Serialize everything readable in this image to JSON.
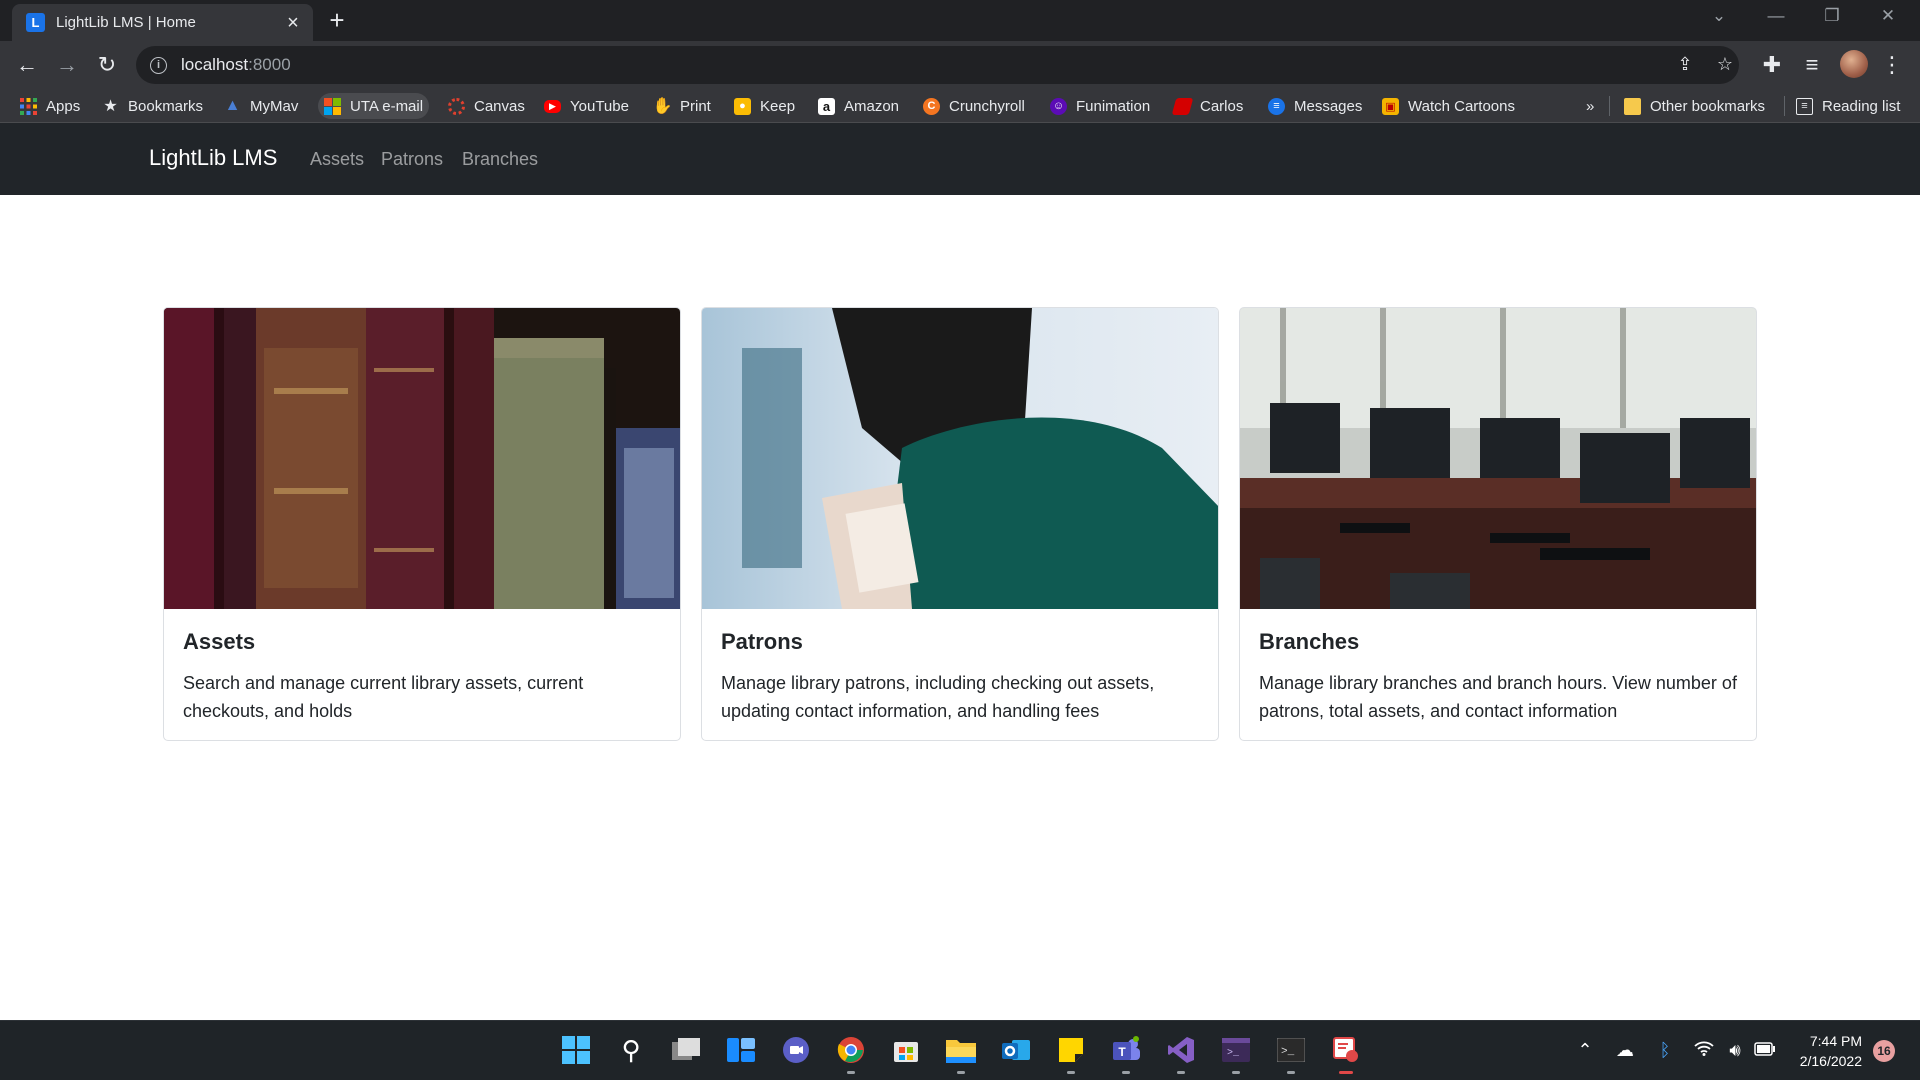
{
  "browser": {
    "tab_title": "LightLib LMS | Home",
    "tab_favicon_letter": "L",
    "url_host": "localhost",
    "url_port": ":8000"
  },
  "bookmarks": [
    {
      "label": "Apps",
      "icon": "apps-grid-icon"
    },
    {
      "label": "Bookmarks",
      "icon": "star-icon"
    },
    {
      "label": "MyMav",
      "icon": "mymav-icon"
    },
    {
      "label": "UTA e-mail",
      "icon": "microsoft-icon"
    },
    {
      "label": "Canvas",
      "icon": "canvas-icon"
    },
    {
      "label": "YouTube",
      "icon": "youtube-icon"
    },
    {
      "label": "Print",
      "icon": "print-icon"
    },
    {
      "label": "Keep",
      "icon": "keep-icon"
    },
    {
      "label": "Amazon",
      "icon": "amazon-icon"
    },
    {
      "label": "Crunchyroll",
      "icon": "crunchyroll-icon"
    },
    {
      "label": "Funimation",
      "icon": "funimation-icon"
    },
    {
      "label": "Carlos",
      "icon": "carlos-icon"
    },
    {
      "label": "Messages",
      "icon": "messages-icon"
    },
    {
      "label": "Watch Cartoons",
      "icon": "cartoons-icon"
    }
  ],
  "bookmarks_overflow": "»",
  "other_bookmarks": "Other bookmarks",
  "reading_list": "Reading list",
  "app": {
    "brand": "LightLib LMS",
    "nav": [
      "Assets",
      "Patrons",
      "Branches"
    ]
  },
  "cards": [
    {
      "title": "Assets",
      "text": "Search and manage current library assets, current checkouts, and holds",
      "image": "old-books-photo"
    },
    {
      "title": "Patrons",
      "text": "Manage library patrons, including checking out assets, updating contact information, and handling fees",
      "image": "woman-reading-photo"
    },
    {
      "title": "Branches",
      "text": "Manage library branches and branch hours. View number of patrons, total assets, and contact information",
      "image": "computer-lab-photo"
    }
  ],
  "taskbar": {
    "time": "7:44 PM",
    "date": "2/16/2022",
    "notifications": "16"
  },
  "colors": {
    "navbar": "#212529",
    "chrome_dark": "#202124",
    "chrome_toolbar": "#35363a",
    "accent": "#1a73e8"
  }
}
